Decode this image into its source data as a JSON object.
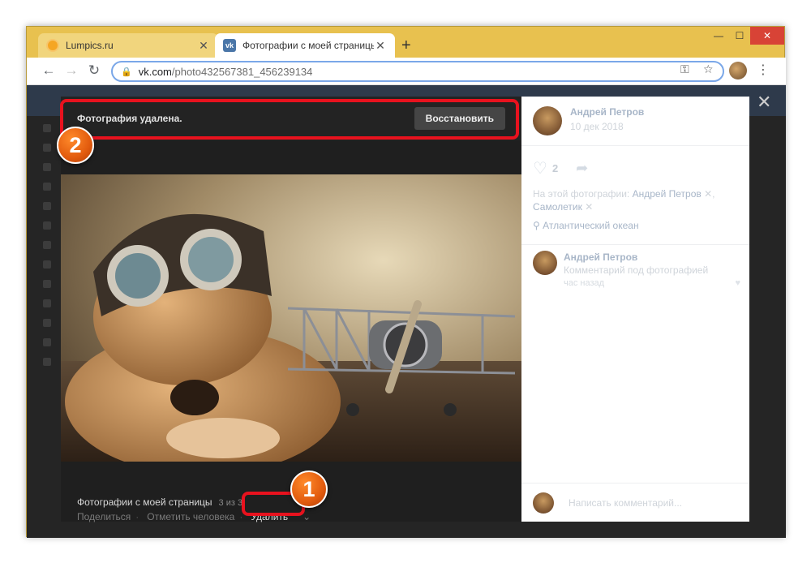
{
  "browser": {
    "tabs": [
      {
        "label": "Lumpics.ru"
      },
      {
        "label": "Фотографии с моей страницы – "
      }
    ],
    "url_host": "vk.com",
    "url_path": "/photo432567381_456239134"
  },
  "notice": {
    "message": "Фотография удалена.",
    "restore_label": "Восстановить"
  },
  "markers": {
    "one": "1",
    "two": "2"
  },
  "photo_footer": {
    "album": "Фотографии с моей страницы",
    "count": "3 из 3",
    "share": "Поделиться",
    "tag": "Отметить человека",
    "delete": "Удалить"
  },
  "sidebar": {
    "author_name": "Андрей Петров",
    "date": "10 дек 2018",
    "likes": "2",
    "on_photo_prefix": "На этой фотографии:",
    "person1": "Андрей Петров",
    "person2": "Самолетик",
    "location": "Атлантический океан",
    "comment": {
      "author": "Андрей Петров",
      "text": "Комментарий под фотографией",
      "time": "час назад"
    },
    "write_placeholder": "Написать комментарий..."
  },
  "colors": {
    "highlight": "#e8121e",
    "marker": "#e25b0e",
    "frame": "#e8c14f"
  }
}
